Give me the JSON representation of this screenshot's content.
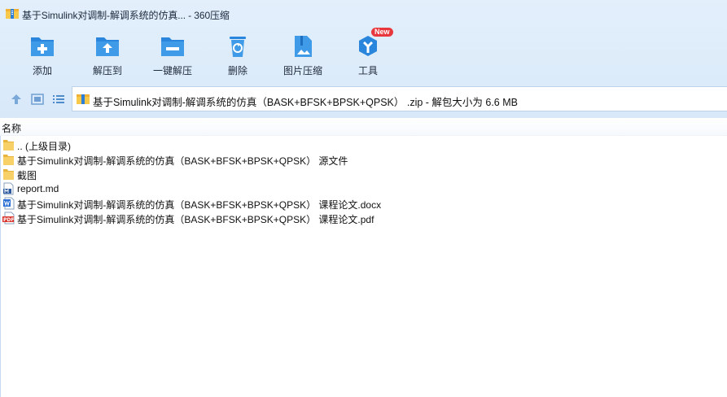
{
  "window": {
    "title": "基于Simulink对调制-解调系统的仿真... - 360压缩",
    "logo_icon": "archive-logo-icon"
  },
  "toolbar": {
    "items": [
      {
        "label": "添加",
        "icon": "add-icon"
      },
      {
        "label": "解压到",
        "icon": "extract-to-icon"
      },
      {
        "label": "一键解压",
        "icon": "one-click-extract-icon"
      },
      {
        "label": "删除",
        "icon": "delete-icon"
      },
      {
        "label": "图片压缩",
        "icon": "image-compress-icon"
      },
      {
        "label": "工具",
        "icon": "tools-icon",
        "badge": "New"
      }
    ]
  },
  "nav": {
    "path": "基于Simulink对调制-解调系统的仿真（BASK+BFSK+BPSK+QPSK） .zip - 解包大小为 6.6 MB"
  },
  "list": {
    "column_name": "名称",
    "items": [
      {
        "name": ".. (上级目录)",
        "type": "folder"
      },
      {
        "name": "基于Simulink对调制-解调系统的仿真（BASK+BFSK+BPSK+QPSK） 源文件",
        "type": "folder"
      },
      {
        "name": "截图",
        "type": "folder"
      },
      {
        "name": "report.md",
        "type": "md"
      },
      {
        "name": "基于Simulink对调制-解调系统的仿真（BASK+BFSK+BPSK+QPSK） 课程论文.docx",
        "type": "docx"
      },
      {
        "name": "基于Simulink对调制-解调系统的仿真（BASK+BFSK+BPSK+QPSK） 课程论文.pdf",
        "type": "pdf"
      }
    ]
  },
  "colors": {
    "accent_blue": "#2d8ee0",
    "title_bg": "#dcebfa",
    "folder_yellow": "#f5c74e",
    "pdf_red": "#d9372e",
    "word_blue": "#2b6fd6",
    "badge_red": "#e8383d"
  }
}
